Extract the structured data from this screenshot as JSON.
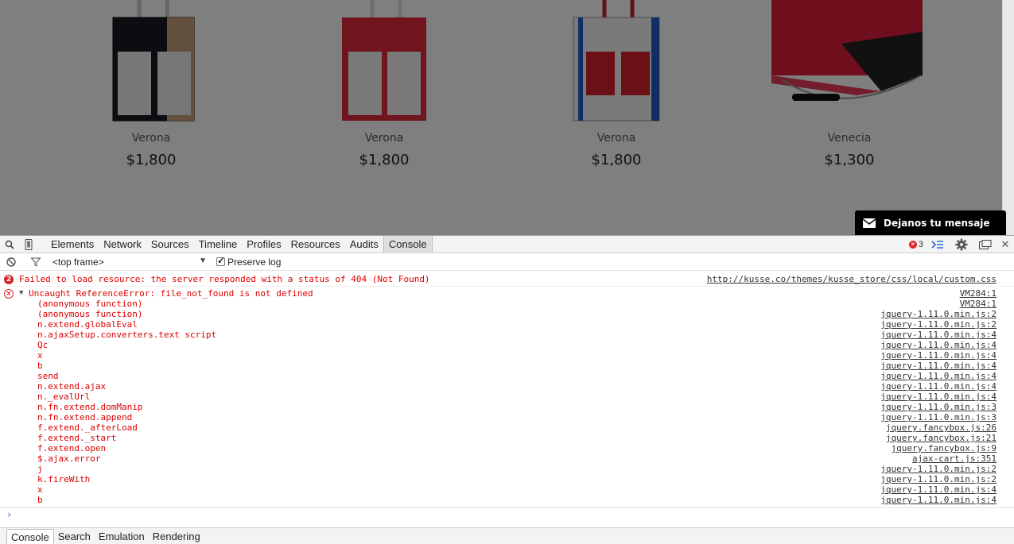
{
  "page": {
    "products": [
      {
        "name": "Verona",
        "price": "$1,800",
        "bag": "black-white-pockets"
      },
      {
        "name": "Verona",
        "price": "$1,800",
        "bag": "red-white-pockets"
      },
      {
        "name": "Verona",
        "price": "$1,800",
        "bag": "white-blue-red-pockets"
      },
      {
        "name": "Venecia",
        "price": "$1,300",
        "bag": "red-black-clutch"
      }
    ],
    "message_widget": {
      "label": "Dejanos tu mensaje",
      "icon": "envelope-icon"
    }
  },
  "devtools": {
    "panel_tabs": [
      "Elements",
      "Network",
      "Sources",
      "Timeline",
      "Profiles",
      "Resources",
      "Audits",
      "Console"
    ],
    "active_tab": "Console",
    "error_count": "3",
    "filter": {
      "frame_select": "<top frame>",
      "preserve_log_label": "Preserve log",
      "preserve_log_checked": true
    },
    "messages": [
      {
        "icon": "error-count-icon",
        "badge": "2",
        "text": "Failed to load resource: the server responded with a status of 404 (Not Found)",
        "source": "http://kusse.co/themes/kusse_store/css/local/custom.css"
      },
      {
        "icon": "error-icon",
        "text": "Uncaught ReferenceError: file_not_found is not defined",
        "source": "VM284:1",
        "stack": [
          {
            "fn": "(anonymous function)",
            "source": "VM284:1"
          },
          {
            "fn": "(anonymous function)",
            "source": "jquery-1.11.0.min.js:2"
          },
          {
            "fn": "n.extend.globalEval",
            "source": "jquery-1.11.0.min.js:2"
          },
          {
            "fn": "n.ajaxSetup.converters.text script",
            "source": "jquery-1.11.0.min.js:4"
          },
          {
            "fn": "Qc",
            "source": "jquery-1.11.0.min.js:4"
          },
          {
            "fn": "x",
            "source": "jquery-1.11.0.min.js:4"
          },
          {
            "fn": "b",
            "source": "jquery-1.11.0.min.js:4"
          },
          {
            "fn": "send",
            "source": "jquery-1.11.0.min.js:4"
          },
          {
            "fn": "n.extend.ajax",
            "source": "jquery-1.11.0.min.js:4"
          },
          {
            "fn": "n._evalUrl",
            "source": "jquery-1.11.0.min.js:4"
          },
          {
            "fn": "n.fn.extend.domManip",
            "source": "jquery-1.11.0.min.js:3"
          },
          {
            "fn": "n.fn.extend.append",
            "source": "jquery-1.11.0.min.js:3"
          },
          {
            "fn": "f.extend._afterLoad",
            "source": "jquery.fancybox.js:26"
          },
          {
            "fn": "f.extend._start",
            "source": "jquery.fancybox.js:21"
          },
          {
            "fn": "f.extend.open",
            "source": "jquery.fancybox.js:9"
          },
          {
            "fn": "$.ajax.error",
            "source": "ajax-cart.js:351"
          },
          {
            "fn": "j",
            "source": "jquery-1.11.0.min.js:2"
          },
          {
            "fn": "k.fireWith",
            "source": "jquery-1.11.0.min.js:2"
          },
          {
            "fn": "x",
            "source": "jquery-1.11.0.min.js:4"
          },
          {
            "fn": "b",
            "source": "jquery-1.11.0.min.js:4"
          }
        ]
      }
    ],
    "prompt": "›",
    "drawer_tabs": [
      "Console",
      "Search",
      "Emulation",
      "Rendering"
    ],
    "active_drawer_tab": "Console"
  }
}
